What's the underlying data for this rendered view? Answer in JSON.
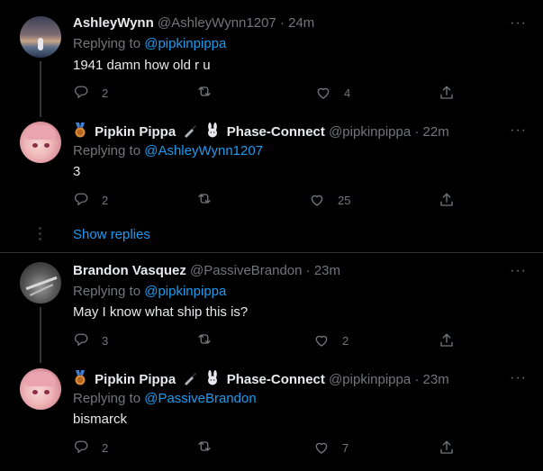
{
  "tweets": [
    {
      "name": "AshleyWynn",
      "handle": "@AshleyWynn1207",
      "time": "· 24m",
      "replying_prefix": "Replying to ",
      "replying_to": "@pipkinpippa",
      "text": "1941 damn how old r u",
      "replies": "2",
      "retweets": "",
      "likes": "4"
    },
    {
      "name": "Pipkin Pippa",
      "name_suffix": "Phase-Connect",
      "handle": "@pipkinpippa",
      "time": "· 22m",
      "replying_prefix": "Replying to ",
      "replying_to": "@AshleyWynn1207",
      "text": "3",
      "replies": "2",
      "retweets": "",
      "likes": "25"
    },
    {
      "name": "Brandon Vasquez",
      "handle": "@PassiveBrandon",
      "time": "· 23m",
      "replying_prefix": "Replying to ",
      "replying_to": "@pipkinpippa",
      "text": "May I know what ship this is?",
      "replies": "3",
      "retweets": "",
      "likes": "2"
    },
    {
      "name": "Pipkin Pippa",
      "name_suffix": "Phase-Connect",
      "handle": "@pipkinpippa",
      "time": "· 23m",
      "replying_prefix": "Replying to ",
      "replying_to": "@PassiveBrandon",
      "text": "bismarck",
      "replies": "2",
      "retweets": "",
      "likes": "7"
    }
  ],
  "show_replies": "Show replies",
  "more_glyph": "···",
  "icons": [
    "reply-icon",
    "retweet-icon",
    "like-icon",
    "share-icon",
    "more-icon",
    "medal-icon",
    "knife-icon",
    "rabbit-icon"
  ],
  "colors": {
    "background": "#000000",
    "text": "#e7e9ea",
    "muted": "#71767b",
    "link": "#1d9bf0",
    "divider": "#2f3336"
  }
}
